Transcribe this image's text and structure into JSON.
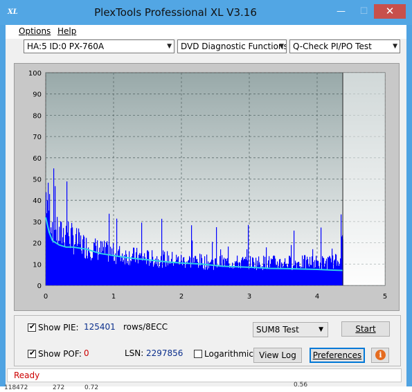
{
  "window": {
    "title": "PlexTools Professional XL V3.16",
    "icon_text": "XL",
    "minimize": "—",
    "maximize": "☐",
    "close": "✕"
  },
  "menu": {
    "items": [
      "Options",
      "Help"
    ]
  },
  "toolbar": {
    "drive": "HA:5 ID:0  PX-760A",
    "function": "DVD Diagnostic Functions",
    "test": "Q-Check PI/PO Test"
  },
  "chart_data": {
    "type": "area",
    "title": "",
    "xlabel": "",
    "ylabel": "",
    "xlim": [
      0,
      5
    ],
    "ylim": [
      0,
      100
    ],
    "x_ticks": [
      "0",
      "1",
      "2",
      "3",
      "4",
      "5"
    ],
    "y_ticks": [
      "0",
      "10",
      "20",
      "30",
      "40",
      "50",
      "60",
      "70",
      "80",
      "90",
      "100"
    ],
    "grid": true,
    "end_marker_x": 4.38,
    "series": [
      {
        "type": "bars",
        "color": "#0000ff",
        "x": [
          0.0,
          0.05,
          0.1,
          0.15,
          0.2,
          0.3,
          0.4,
          0.5,
          0.6,
          0.8,
          1.0,
          1.2,
          1.4,
          1.6,
          1.8,
          2.0,
          2.2,
          2.4,
          2.6,
          2.8,
          3.0,
          3.2,
          3.4,
          3.6,
          3.8,
          4.0,
          4.2,
          4.3,
          4.38
        ],
        "y": [
          51,
          44,
          35,
          30,
          28,
          31,
          26,
          24,
          22,
          20,
          18,
          17,
          16,
          15,
          15,
          14,
          14,
          13,
          13,
          13,
          13,
          13,
          13,
          13,
          13,
          13,
          13,
          14,
          25
        ]
      },
      {
        "type": "line",
        "color": "#32d2e6",
        "x": [
          0.0,
          0.05,
          0.1,
          0.2,
          0.3,
          0.4,
          0.6,
          0.8,
          1.0,
          1.2,
          1.5,
          1.8,
          2.0,
          2.3,
          2.6,
          3.0,
          3.3,
          3.6,
          4.0,
          4.2,
          4.38
        ],
        "y": [
          32,
          25,
          21,
          19,
          18,
          18,
          17,
          15,
          14,
          13,
          12,
          11,
          10.5,
          10,
          9,
          8.5,
          8,
          7.8,
          7.5,
          7.2,
          7
        ]
      }
    ]
  },
  "controls": {
    "show_pie_label": "Show PIE:",
    "pie_value": "125401",
    "rows_unit": "rows/8ECC",
    "show_pof_label": "Show POF:",
    "pof_value": "0",
    "lsn_label": "LSN:",
    "lsn_value": "2297856",
    "logarithmic_label": "Logarithmic",
    "test_select": "SUM8 Test",
    "start_button": "Start",
    "view_log_button": "View Log",
    "preferences_button": "Preferences",
    "info_icon": "i",
    "colors": {
      "pie_value": "#0a2e8c",
      "pof_value": "#cc0000"
    }
  },
  "status": {
    "text": "Ready",
    "color": "#cc0000"
  },
  "background_text": [
    "118472",
    "272",
    "0.72",
    "0.56"
  ]
}
